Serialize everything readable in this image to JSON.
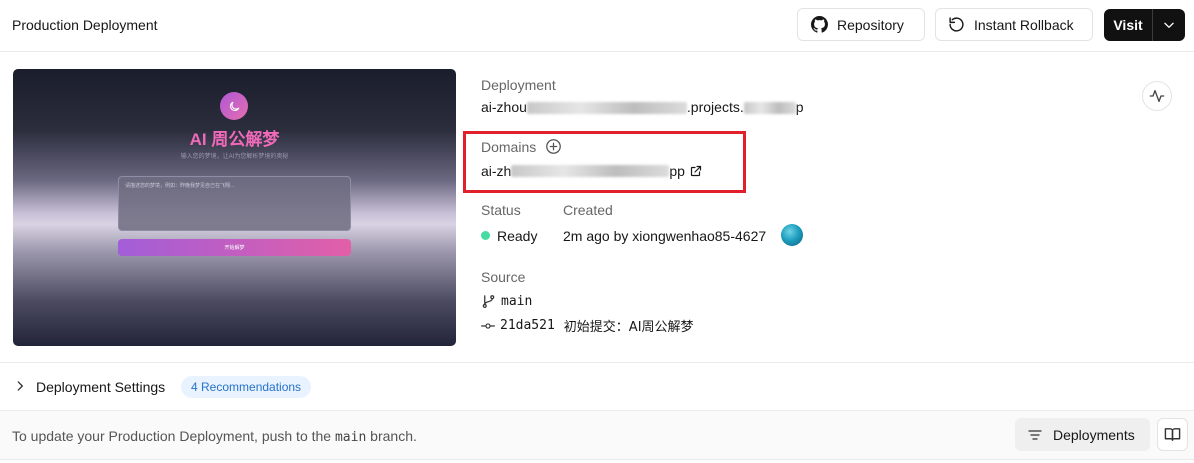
{
  "header": {
    "title": "Production Deployment",
    "repository_label": "Repository",
    "rollback_label": "Instant Rollback",
    "visit_label": "Visit"
  },
  "preview": {
    "app_title": "AI 周公解梦",
    "subtitle": "输入您的梦境，让AI为您解析梦境的奥秘",
    "input_placeholder": "请描述您的梦境，例如：昨晚我梦见自己在飞翔...",
    "button_label": "开始解梦"
  },
  "deployment": {
    "label": "Deployment",
    "url_prefix": "ai-zhou",
    "url_middle": ".projects.",
    "url_suffix": "p"
  },
  "domains": {
    "label": "Domains",
    "url_prefix": "ai-zh",
    "url_suffix": "pp"
  },
  "status": {
    "label": "Status",
    "value": "Ready",
    "dot_color": "#45dca3"
  },
  "created": {
    "label": "Created",
    "value": "2m ago by xiongwenhao85-4627"
  },
  "source": {
    "label": "Source",
    "branch": "main",
    "commit_hash": "21da521",
    "commit_message": "初始提交：AI周公解梦"
  },
  "settings": {
    "title": "Deployment Settings",
    "recommendations": "4 Recommendations"
  },
  "footer": {
    "text_before": "To update your Production Deployment, push to the ",
    "branch": "main",
    "text_after": " branch.",
    "deployments_label": "Deployments"
  },
  "colors": {
    "highlight": "#e0202a",
    "badge_bg": "#e9f3ff",
    "badge_text": "#2771c7"
  }
}
